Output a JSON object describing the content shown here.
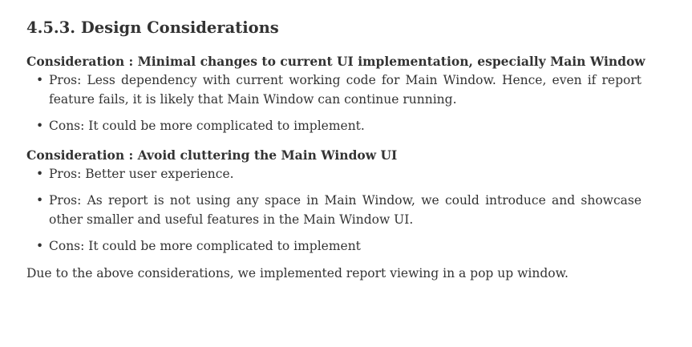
{
  "section": {
    "heading": "4.5.3. Design Considerations"
  },
  "considerations": [
    {
      "title": "Consideration : Minimal changes to current UI implementation, especially Main Window",
      "points": [
        "Pros: Less dependency with current working code for Main Window. Hence, even if report feature fails, it is likely that Main Window can continue running.",
        "Cons: It could be more complicated to implement."
      ]
    },
    {
      "title": "Consideration : Avoid cluttering the Main Window UI",
      "points": [
        "Pros: Better user experience.",
        "Pros: As report is not using any space in Main Window, we could introduce and showcase other smaller and useful features in the Main Window UI.",
        "Cons: It could be more complicated to implement"
      ]
    }
  ],
  "conclusion": "Due to the above considerations, we implemented report viewing in a pop up window.",
  "bullet_glyph": "•"
}
